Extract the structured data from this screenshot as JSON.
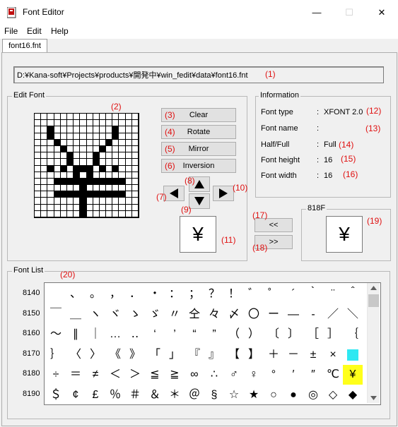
{
  "window": {
    "title": "Font Editor",
    "minimize": "—",
    "maximize": "☐",
    "close": "✕"
  },
  "menu": [
    "File",
    "Edit",
    "Help"
  ],
  "tab": "font16.fnt",
  "path": {
    "text": "D:¥Kana-soft¥Projects¥products¥開発中¥win_fedit¥data¥font16.fnt",
    "num": "(1)"
  },
  "edit_font": {
    "label": "Edit Font",
    "num": "(2)",
    "bitmap": [
      "0000000000000000",
      "0000000000000000",
      "0010000000001000",
      "0010000000001000",
      "0001000000010000",
      "0000100000100000",
      "0000010001000000",
      "0000010001000000",
      "0010101110101000",
      "0000001010000000",
      "0001111111111100",
      "0000000100000000",
      "0001111111111100",
      "0000000100000000",
      "0000000100000000",
      "0000000100000000"
    ]
  },
  "buttons": [
    {
      "num": "(3)",
      "label": "Clear"
    },
    {
      "num": "(4)",
      "label": "Rotate"
    },
    {
      "num": "(5)",
      "label": "Mirror"
    },
    {
      "num": "(6)",
      "label": "Inversion"
    }
  ],
  "arrow_nums": {
    "up": "(8)",
    "left": "(7)",
    "right": "(10)",
    "down": "(9)"
  },
  "preview": {
    "char": "¥",
    "num": "(11)"
  },
  "information": {
    "label": "Information",
    "rows": [
      {
        "label": "Font type",
        "colon": ":",
        "value": "XFONT 2.0",
        "num": "(12)"
      },
      {
        "label": "Font name",
        "colon": ":",
        "value": "",
        "num": "(13)"
      },
      {
        "label": "Half/Full",
        "colon": ":",
        "value": "Full",
        "num": "(14)"
      },
      {
        "label": "Font height",
        "colon": ":",
        "value": "16",
        "num": "(15)"
      },
      {
        "label": "Font width",
        "colon": ":",
        "value": "16",
        "num": "(16)"
      }
    ]
  },
  "transfer": {
    "prev_label": "<<",
    "prev_num": "(17)",
    "next_label": ">>",
    "next_num": "(18)"
  },
  "code_group": {
    "label": "818F",
    "char": "¥",
    "num": "(19)"
  },
  "font_list": {
    "label": "Font List",
    "num": "(20)",
    "rows": [
      {
        "code": "8140",
        "chars": [
          " ",
          "、",
          "。",
          "，",
          "．",
          "・",
          "：",
          "；",
          "？",
          "！",
          "゛",
          "゜",
          "´",
          "｀",
          "¨",
          "＾"
        ]
      },
      {
        "code": "8150",
        "chars": [
          "￣",
          "＿",
          "ヽ",
          "ヾ",
          "ゝ",
          "ゞ",
          "〃",
          "仝",
          "々",
          "〆",
          "〇",
          "ー",
          "―",
          "‐",
          "／",
          "＼"
        ]
      },
      {
        "code": "8160",
        "chars": [
          "～",
          "∥",
          "｜",
          "…",
          "‥",
          "‘",
          "’",
          "“",
          "”",
          "（",
          "）",
          "〔",
          "〕",
          "［",
          "］",
          "｛"
        ]
      },
      {
        "code": "8170",
        "chars": [
          "｝",
          "〈",
          "〉",
          "《",
          "》",
          "「",
          "」",
          "『",
          "』",
          "【",
          "】",
          "＋",
          "－",
          "±",
          "×",
          ""
        ]
      },
      {
        "code": "8180",
        "chars": [
          "÷",
          "＝",
          "≠",
          "＜",
          "＞",
          "≦",
          "≧",
          "∞",
          "∴",
          "♂",
          "♀",
          "°",
          "′",
          "″",
          "℃",
          "¥"
        ]
      },
      {
        "code": "8190",
        "chars": [
          "＄",
          "¢",
          "£",
          "％",
          "＃",
          "＆",
          "＊",
          "＠",
          "§",
          "☆",
          "★",
          "○",
          "●",
          "◎",
          "◇",
          "◆"
        ]
      }
    ]
  },
  "colors": {
    "cursor_cell": "#2ee8f2",
    "selected_cell": "#ffff1a",
    "annotation": "#e01010"
  }
}
